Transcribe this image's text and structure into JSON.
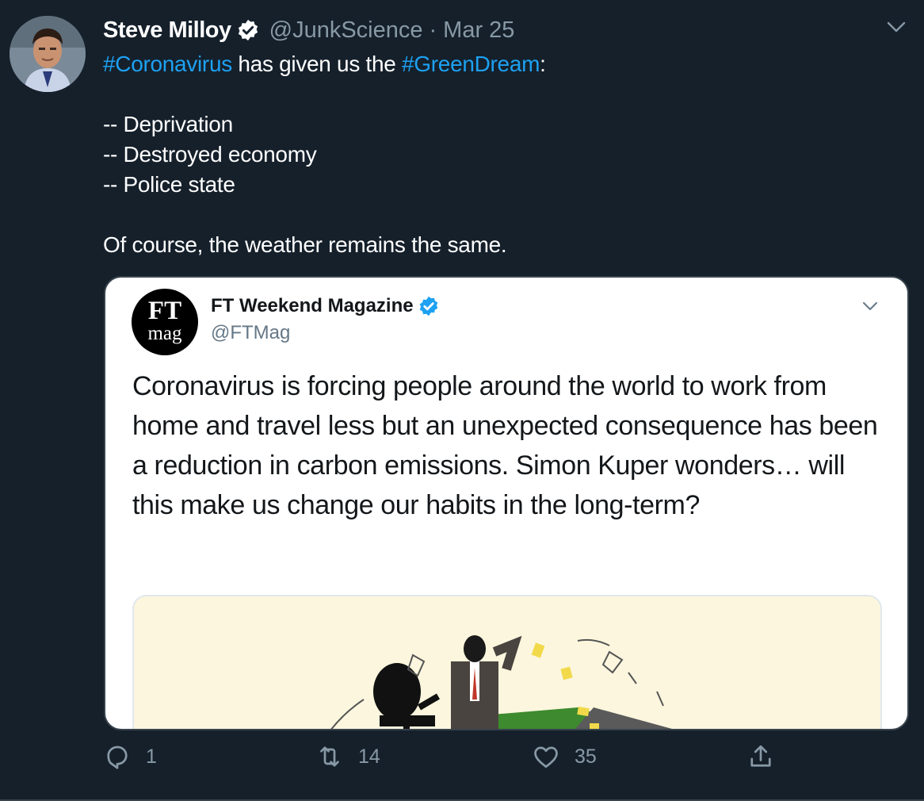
{
  "tweet": {
    "author": {
      "display_name": "Steve Milloy",
      "handle": "@JunkScience",
      "separator": "·",
      "date": "Mar 25"
    },
    "text": {
      "line1_hashtag1": "#Coronavirus",
      "line1_mid": " has given us the ",
      "line1_hashtag2": "#GreenDream",
      "line1_end": ":",
      "item1": "-- Deprivation",
      "item2": "-- Destroyed economy",
      "item3": "-- Police state",
      "closing": "Of course, the weather remains the same."
    },
    "quoted": {
      "logo_top": "FT",
      "logo_bottom": "mag",
      "display_name": "FT Weekend Magazine",
      "handle": "@FTMag",
      "text": "Coronavirus is forcing people around the world to work from home and travel less but an unexpected consequence has been a reduction in carbon emissions. Simon Kuper wonders… will this make us change our habits in the long-term?"
    },
    "actions": {
      "replies": "1",
      "retweets": "14",
      "likes": "35"
    }
  },
  "colors": {
    "background": "#15202b",
    "link": "#1da1f2",
    "muted": "#8899a6",
    "verified": "#1da1f2"
  }
}
